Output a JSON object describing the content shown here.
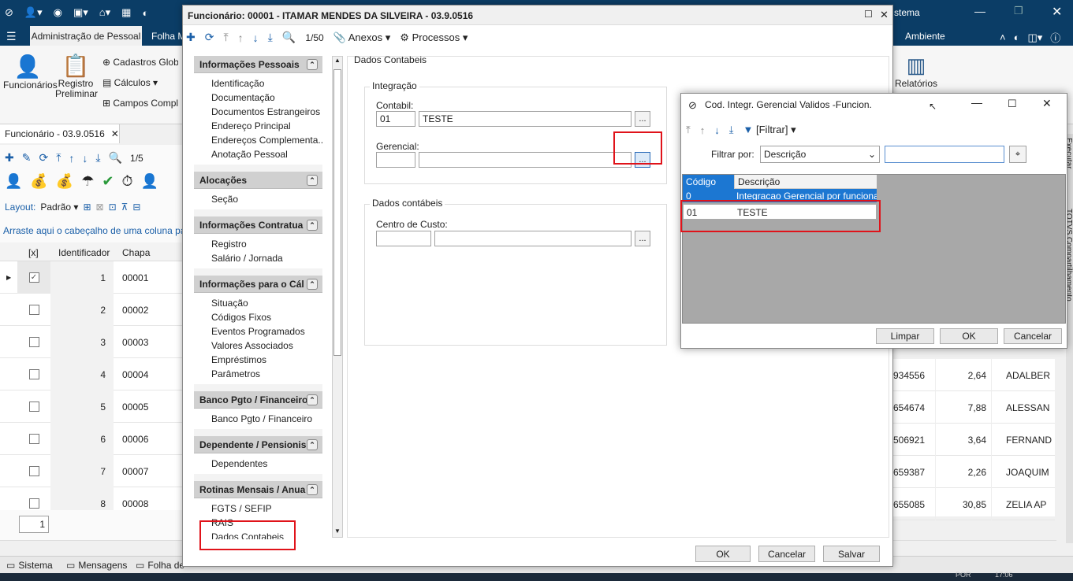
{
  "app": {
    "tabs": [
      "Administração de Pessoal",
      "Folha M"
    ],
    "title_right": "stema",
    "ambiente": "Ambiente",
    "ribbon": {
      "funcionarios": "Funcionários",
      "registro": "Registro Preliminar",
      "cadastros": "Cadastros Glob",
      "calculos": "Cálculos",
      "campos": "Campos Compl",
      "relatorios": "Relatórios"
    },
    "doc_tab": "Funcionário - 03.9.0516",
    "counter": "1/5",
    "layout_label": "Layout:",
    "layout_value": "Padrão",
    "group_hint": "Arraste aqui o cabeçalho de uma coluna para a",
    "columns": [
      "[x]",
      "Identificador",
      "Chapa"
    ],
    "rows": [
      {
        "id": "1",
        "chapa": "00001",
        "checked": true
      },
      {
        "id": "2",
        "chapa": "00002",
        "checked": false
      },
      {
        "id": "3",
        "chapa": "00003",
        "checked": false
      },
      {
        "id": "4",
        "chapa": "00004",
        "checked": false
      },
      {
        "id": "5",
        "chapa": "00005",
        "checked": false
      },
      {
        "id": "6",
        "chapa": "00006",
        "checked": false
      },
      {
        "id": "7",
        "chapa": "00007",
        "checked": false
      },
      {
        "id": "8",
        "chapa": "00008",
        "checked": false
      }
    ],
    "right_rows": [
      {
        "a": "934556",
        "b": "2,64",
        "c": "ADALBER"
      },
      {
        "a": "654674",
        "b": "7,88",
        "c": "ALESSAN"
      },
      {
        "a": "506921",
        "b": "3,64",
        "c": "FERNAND"
      },
      {
        "a": "659387",
        "b": "2,26",
        "c": "JOAQUIM"
      },
      {
        "a": "655085",
        "b": "30,85",
        "c": "ZELIA AP"
      }
    ],
    "page_box": "1",
    "bottom_tabs": [
      "Sistema",
      "Mensagens",
      "Folha de"
    ],
    "side_tabs": [
      "Executar",
      "TOTVS Compartilhamento"
    ],
    "taskbar_right": [
      "POR",
      "17:06"
    ]
  },
  "dialog": {
    "title": "Funcionário: 00001 - ITAMAR MENDES DA SILVEIRA - 03.9.0516",
    "counter": "1/50",
    "anexos": "Anexos",
    "processos": "Processos",
    "sections": [
      {
        "title": "Informações Pessoais",
        "items": [
          "Identificação",
          "Documentação",
          "Documentos Estrangeiros",
          "Endereço Principal",
          "Endereços Complementa...",
          "Anotação Pessoal"
        ]
      },
      {
        "title": "Alocações",
        "items": [
          "Seção"
        ]
      },
      {
        "title": "Informações Contratua",
        "items": [
          "Registro",
          "Salário / Jornada"
        ]
      },
      {
        "title": "Informações para o Cál",
        "items": [
          "Situação",
          "Códigos Fixos",
          "Eventos Programados",
          "Valores Associados",
          "Empréstimos",
          "Parâmetros"
        ]
      },
      {
        "title": "Banco Pgto / Financeiro",
        "items": [
          "Banco Pgto / Financeiro"
        ]
      },
      {
        "title": "Dependente / Pensionis",
        "items": [
          "Dependentes"
        ]
      },
      {
        "title": "Rotinas Mensais / Anua",
        "items": [
          "FGTS / SEFIP",
          "RAIS",
          "Dados Contabeis"
        ]
      }
    ],
    "panel_title": "Dados Contabeis",
    "integracao": "Integração",
    "contabil_label": "Contabil:",
    "contabil_code": "01",
    "contabil_desc": "TESTE",
    "gerencial_label": "Gerencial:",
    "gerencial_code": "",
    "gerencial_desc": "",
    "dados_contabeis": "Dados contábeis",
    "centro_label": "Centro de Custo:",
    "centro_code": "",
    "centro_desc": "",
    "ellipsis": "...",
    "ok": "OK",
    "cancelar": "Cancelar",
    "salvar": "Salvar"
  },
  "lookup": {
    "title": "Cod. Integr. Gerencial Validos -Funcion.",
    "filtrar": "[Filtrar]",
    "filtrar_por": "Filtrar por:",
    "filter_field": "Descrição",
    "filter_value": "",
    "columns": [
      "Código",
      "Descrição"
    ],
    "rows": [
      {
        "codigo": "0",
        "descricao": "Integracao Gerencial por funcionario"
      },
      {
        "codigo": "01",
        "descricao": "TESTE"
      }
    ],
    "limpar": "Limpar",
    "ok": "OK",
    "cancelar": "Cancelar"
  },
  "colors": {
    "titlebar": "#0b3d66",
    "accent": "#1a5fa8",
    "highlight_red": "#e0131a",
    "selected_row": "#1c77d2"
  }
}
